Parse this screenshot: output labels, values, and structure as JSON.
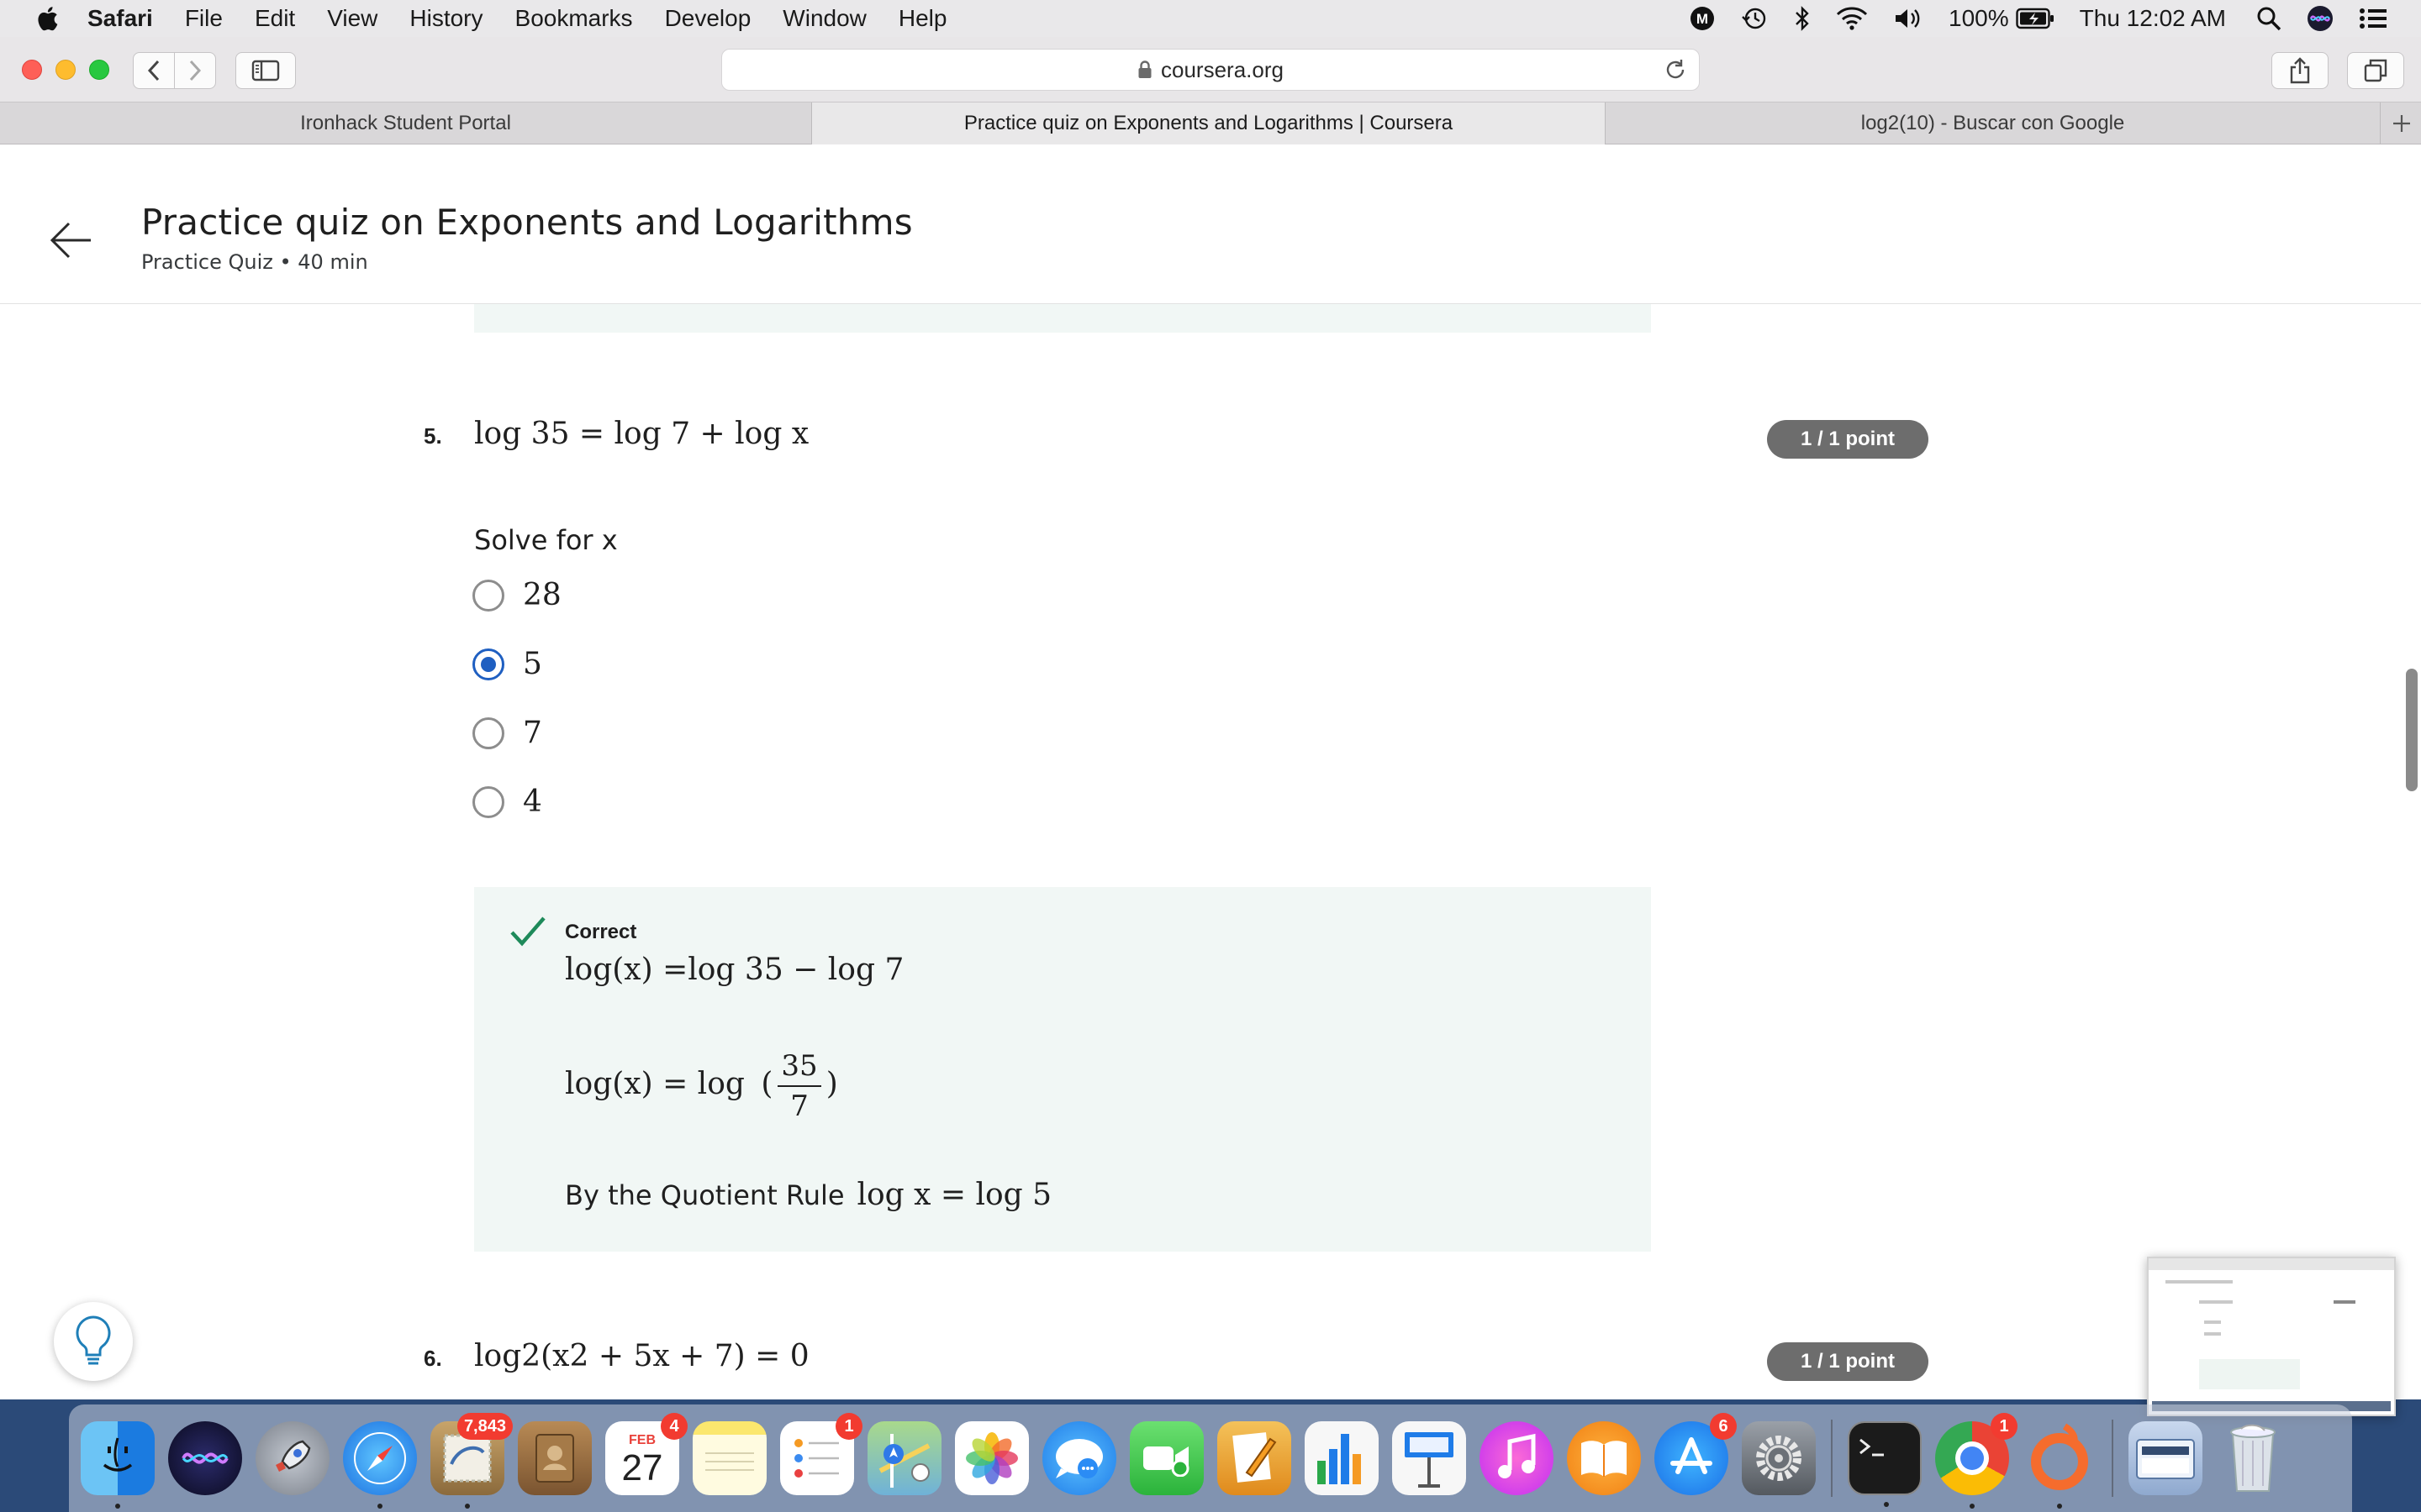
{
  "menubar": {
    "app": "Safari",
    "items": [
      "File",
      "Edit",
      "View",
      "History",
      "Bookmarks",
      "Develop",
      "Window",
      "Help"
    ],
    "battery": "100%",
    "clock": "Thu 12:02 AM"
  },
  "browser": {
    "url": "coursera.org",
    "tabs": [
      {
        "label": "Ironhack Student Portal",
        "active": false
      },
      {
        "label": "Practice quiz on Exponents and Logarithms | Coursera",
        "active": true
      },
      {
        "label": "log2(10) - Buscar con Google",
        "active": false
      }
    ]
  },
  "page": {
    "title": "Practice quiz on Exponents and Logarithms",
    "subtitle": "Practice Quiz • 40 min"
  },
  "question5": {
    "number": "5.",
    "equation": "log 35 = log 7 + log x",
    "points": "1 / 1 point",
    "prompt": "Solve for x",
    "options": [
      {
        "label": "28",
        "selected": false
      },
      {
        "label": "5",
        "selected": true
      },
      {
        "label": "7",
        "selected": false
      },
      {
        "label": "4",
        "selected": false
      }
    ],
    "feedback": {
      "status": "Correct",
      "line1": "log(x) =log 35 − log 7",
      "line2_prefix": "log(x) = log",
      "line2_num": "35",
      "line2_den": "7",
      "rule_text": "By the Quotient Rule",
      "rule_math": "log x = log 5"
    }
  },
  "question6": {
    "number": "6.",
    "equation": "log2(x2 + 5x + 7) = 0",
    "points": "1 / 1 point"
  },
  "dock": {
    "mail_badge": "7,843",
    "calendar_month": "FEB",
    "calendar_day": "27",
    "calendar_badge": "4",
    "reminders_badge": "1",
    "appstore_badge": "6",
    "chrome_badge": "1"
  },
  "colors": {
    "accent_blue": "#1f5fc1",
    "correct_green": "#1e8a5a",
    "feedback_bg": "#f1f7f5",
    "points_pill": "#6d6d6d"
  }
}
